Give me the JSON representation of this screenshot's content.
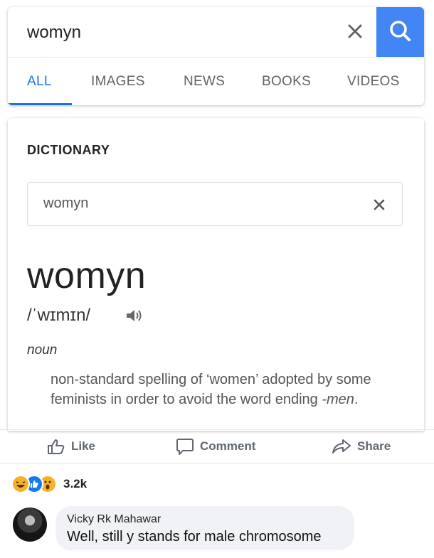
{
  "search": {
    "query": "womyn"
  },
  "tabs": [
    {
      "label": "ALL"
    },
    {
      "label": "IMAGES"
    },
    {
      "label": "NEWS"
    },
    {
      "label": "BOOKS"
    },
    {
      "label": "VIDEOS"
    }
  ],
  "dictionary": {
    "heading": "DICTIONARY",
    "input_value": "womyn",
    "headword": "womyn",
    "pronunciation": "/ˈwɪmɪn/",
    "part_of_speech": "noun",
    "definition_main": "non-standard spelling of ‘women’ adopted by some feminists in order to avoid the word ending ",
    "definition_suffix": "-men",
    "definition_end": "."
  },
  "actions": {
    "like": "Like",
    "comment": "Comment",
    "share": "Share"
  },
  "reactions": {
    "count": "3.2k",
    "icons": [
      "haha-icon",
      "like-icon",
      "wow-icon"
    ]
  },
  "comment": {
    "author": "Vicky Rk Mahawar",
    "text": "Well, still y stands for male chromosome"
  },
  "colors": {
    "accent": "#1a73e8",
    "search_button": "#4285f4",
    "fb_gray": "#606770"
  }
}
